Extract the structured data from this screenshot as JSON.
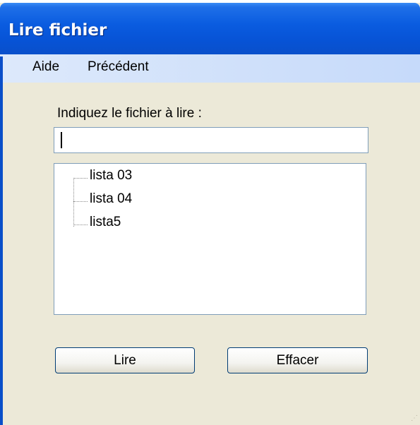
{
  "window": {
    "title": "Lire fichier"
  },
  "menu": {
    "items": [
      "Aide",
      "Précédent"
    ]
  },
  "form": {
    "prompt": "Indiquez le fichier à lire :",
    "input_value": ""
  },
  "tree": {
    "items": [
      "lista 03",
      "lista 04",
      "lista5"
    ]
  },
  "buttons": {
    "read": "Lire",
    "clear": "Effacer"
  },
  "colors": {
    "titlebar": "#0a5ce0",
    "window_bg": "#ece9d8",
    "menubar": "#c6dafa",
    "border": "#7f9db9"
  }
}
